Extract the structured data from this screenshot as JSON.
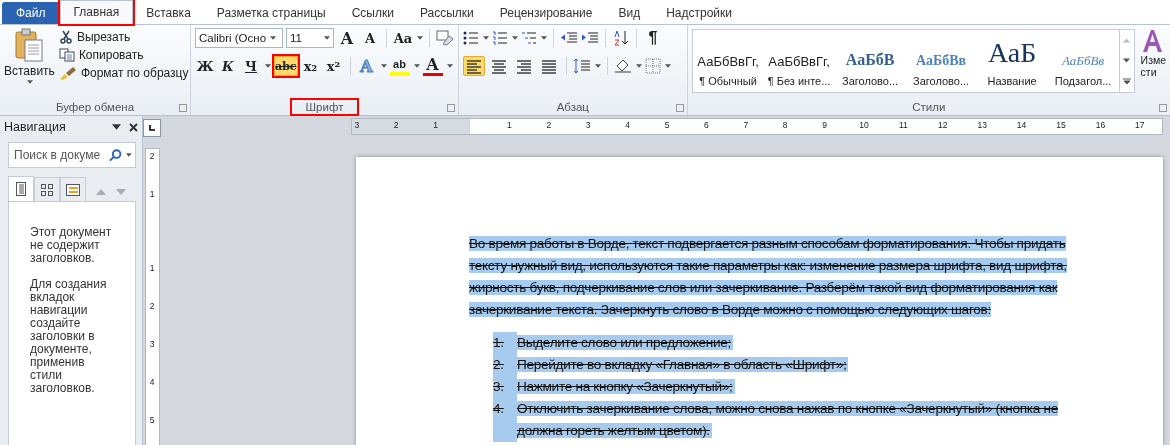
{
  "tabs": [
    {
      "label": "Файл",
      "kind": "file",
      "selected": false,
      "annotated": false
    },
    {
      "label": "Главная",
      "kind": "tab",
      "selected": true,
      "annotated": true
    },
    {
      "label": "Вставка",
      "kind": "tab",
      "selected": false,
      "annotated": false
    },
    {
      "label": "Разметка страницы",
      "kind": "tab",
      "selected": false,
      "annotated": false
    },
    {
      "label": "Ссылки",
      "kind": "tab",
      "selected": false,
      "annotated": false
    },
    {
      "label": "Рассылки",
      "kind": "tab",
      "selected": false,
      "annotated": false
    },
    {
      "label": "Рецензирование",
      "kind": "tab",
      "selected": false,
      "annotated": false
    },
    {
      "label": "Вид",
      "kind": "tab",
      "selected": false,
      "annotated": false
    },
    {
      "label": "Надстройки",
      "kind": "tab",
      "selected": false,
      "annotated": false
    }
  ],
  "clipboard": {
    "paste": "Вставить",
    "actions": [
      {
        "label": "Вырезать"
      },
      {
        "label": "Копировать"
      },
      {
        "label": "Формат по образцу"
      }
    ],
    "group_label": "Буфер обмена"
  },
  "font": {
    "font_name": "Calibri (Осно",
    "font_size": "11",
    "grow": "A",
    "shrink": "A",
    "change_case": "Aa",
    "buttons": [
      {
        "glyph": "Ж",
        "kind": "bold",
        "pressed": false,
        "annotated": false
      },
      {
        "glyph": "К",
        "kind": "italic",
        "pressed": false,
        "annotated": false
      },
      {
        "glyph": "Ч",
        "kind": "underline",
        "pressed": false,
        "annotated": false
      },
      {
        "glyph": "abc",
        "kind": "strike",
        "pressed": true,
        "annotated": true
      },
      {
        "glyph": "x₂",
        "kind": "sub",
        "pressed": false,
        "annotated": false
      },
      {
        "glyph": "x²",
        "kind": "sup",
        "pressed": false,
        "annotated": false
      }
    ],
    "effects": "A",
    "highlight": "ab",
    "font_color": "A",
    "group_label": "Шрифт",
    "annotated": true
  },
  "paragraph": {
    "pilcrow": "¶",
    "align": [
      {
        "kind": "left",
        "selected": true
      },
      {
        "kind": "center",
        "selected": false
      },
      {
        "kind": "right",
        "selected": false
      },
      {
        "kind": "justify",
        "selected": false
      }
    ],
    "group_label": "Абзац"
  },
  "styles": {
    "items": [
      {
        "preview": "АаБбВвГг,",
        "name": "¶ Обычный",
        "kind": "normal"
      },
      {
        "preview": "АаБбВвГг,",
        "name": "¶ Без инте...",
        "kind": "normal"
      },
      {
        "preview": "АаБбВ",
        "name": "Заголово...",
        "kind": "heading1"
      },
      {
        "preview": "АаБбВв",
        "name": "Заголово...",
        "kind": "heading2"
      },
      {
        "preview": "АаБ",
        "name": "Название",
        "kind": "title"
      },
      {
        "preview": "АаБбВв",
        "name": "Подзагол...",
        "kind": "subtitle"
      }
    ],
    "change_styles": [
      "Изме",
      "сти"
    ],
    "group_label": "Стили"
  },
  "navigation": {
    "title": "Навигация",
    "search": {
      "placeholder": "Поиск в докуме"
    },
    "views": [
      {
        "kind": "headings",
        "selected": true
      },
      {
        "kind": "pages",
        "selected": false
      },
      {
        "kind": "results",
        "selected": false
      }
    ],
    "messages": [
      "Этот документ не содержит заголовков.",
      "Для создания вкладок навигации создайте заголовки в документе, применив стили заголовков."
    ]
  },
  "ruler": {
    "horizontal": [
      "3",
      "2",
      "1",
      "1",
      "2",
      "3",
      "4",
      "5",
      "6",
      "7",
      "8",
      "9",
      "10",
      "11",
      "12",
      "13",
      "14",
      "15",
      "16",
      "17"
    ],
    "vertical": [
      "2",
      "1",
      "1",
      "2",
      "3",
      "4",
      "5"
    ]
  },
  "document": {
    "paragraph": "Во время работы в Ворде, текст подвергается разным способам форматирования. Чтобы придать тексту нужный вид, используются такие параметры как: изменение размера шрифта, вид шрифта, жирность букв, подчеркивание слов или зачеркивание. Разберём такой вид форматирования как зачеркивание текста. Зачеркнуть слово в Ворде можно с помощью следующих шагов:",
    "steps": [
      {
        "number": "1.",
        "text": "Выделите слово или предложение;"
      },
      {
        "number": "2.",
        "text": "Перейдите во вкладку «Главная» в область «Шрифт»;"
      },
      {
        "number": "3.",
        "text": "Нажмите на кнопку «Зачеркнутый»;"
      },
      {
        "number": "4.",
        "text": "Отключить зачеркивание слова, можно снова нажав по кнопке «Зачеркнутый» (кнопка не должна гореть желтым цветом)."
      }
    ],
    "selected": true,
    "strikethrough": true
  }
}
